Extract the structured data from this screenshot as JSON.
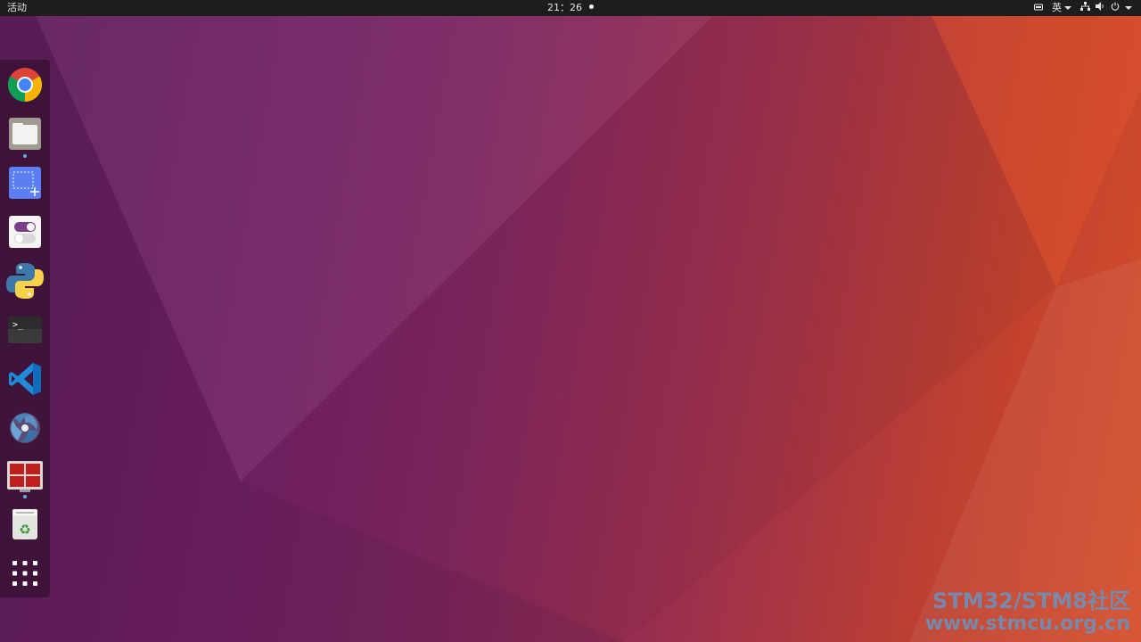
{
  "topbar": {
    "activities_label": "活动",
    "clock": "21：26",
    "ime_label": "英"
  },
  "dock": {
    "items": [
      {
        "name": "google-chrome",
        "icon": "chrome-icon"
      },
      {
        "name": "files",
        "icon": "folder-icon",
        "running": true
      },
      {
        "name": "screenshot",
        "icon": "screenshot-icon"
      },
      {
        "name": "tweaks",
        "icon": "toggle-switch-icon"
      },
      {
        "name": "python",
        "icon": "python-icon"
      },
      {
        "name": "terminal",
        "icon": "terminal-icon",
        "terminal_prompt": ">_"
      },
      {
        "name": "visual-studio-code",
        "icon": "vscode-icon"
      },
      {
        "name": "spiral-app",
        "icon": "spiral-icon"
      },
      {
        "name": "multi-terminal",
        "icon": "multi-terminal-icon",
        "running": true
      },
      {
        "name": "trash",
        "icon": "recycle-bin-icon",
        "trash_symbol": "♻"
      },
      {
        "name": "show-applications",
        "icon": "grid-icon"
      }
    ]
  },
  "watermark": {
    "line1": "STM32/STM8社区",
    "line2": "www.stmcu.org.cn"
  },
  "colors": {
    "topbar_bg": "#1d1d1d",
    "wallpaper_purple": "#6b1f63",
    "wallpaper_orange": "#d44e2a",
    "running_indicator": "#5fb0e6"
  }
}
